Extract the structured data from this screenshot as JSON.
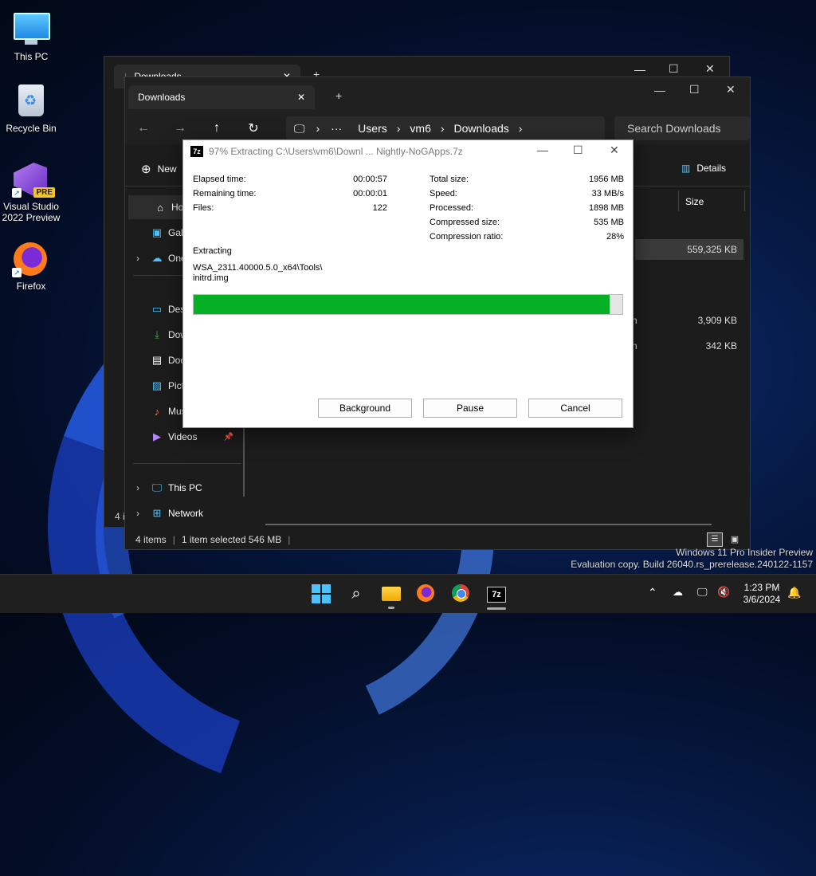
{
  "desktop": {
    "icons": [
      {
        "label": "This PC",
        "icon": "monitor-icon"
      },
      {
        "label": "Recycle Bin",
        "icon": "recycle-bin-icon"
      },
      {
        "label": "Visual Studio 2022 Preview",
        "icon": "visual-studio-icon",
        "badge": "PRE"
      },
      {
        "label": "Firefox",
        "icon": "firefox-icon"
      }
    ]
  },
  "explorer_back": {
    "tab_title": "Downloads",
    "partial_left_char": "4 i"
  },
  "explorer": {
    "tab_title": "Downloads",
    "new_tab_symbol": "+",
    "breadcrumb": [
      "Users",
      "vm6",
      "Downloads"
    ],
    "more_symbol": "···",
    "search_placeholder": "Search Downloads",
    "new_label": "New",
    "details_label": "Details",
    "column_size": "Size",
    "sidebar": [
      {
        "label": "Home",
        "icon": "home-icon"
      },
      {
        "label": "Gallery",
        "icon": "gallery-icon"
      },
      {
        "label": "OneDrive",
        "icon": "onedrive-icon"
      },
      {
        "label": "Desktop",
        "icon": "desktop-icon"
      },
      {
        "label": "Downloads",
        "icon": "download-icon"
      },
      {
        "label": "Documents",
        "icon": "documents-icon"
      },
      {
        "label": "Pictures",
        "icon": "pictures-icon"
      },
      {
        "label": "Music",
        "icon": "music-icon"
      },
      {
        "label": "Videos",
        "icon": "videos-icon"
      },
      {
        "label": "This PC",
        "icon": "this-pc-icon"
      },
      {
        "label": "Network",
        "icon": "network-icon"
      }
    ],
    "file_sizes": [
      "559,325 KB",
      "3,909 KB",
      "342 KB"
    ],
    "file_partial_chars": [
      "n",
      "n"
    ],
    "status_items": "4 items",
    "status_selected": "1 item selected  546 MB"
  },
  "dialog": {
    "title": "97% Extracting C:\\Users\\vm6\\Downl ... Nightly-NoGApps.7z",
    "logo": "7z",
    "left": [
      {
        "k": "Elapsed time:",
        "v": "00:00:57"
      },
      {
        "k": "Remaining time:",
        "v": "00:00:01"
      },
      {
        "k": "Files:",
        "v": "122"
      }
    ],
    "right": [
      {
        "k": "Total size:",
        "v": "1956 MB"
      },
      {
        "k": "Speed:",
        "v": "33 MB/s"
      },
      {
        "k": "Processed:",
        "v": "1898 MB"
      },
      {
        "k": "Compressed size:",
        "v": "535 MB"
      },
      {
        "k": "Compression ratio:",
        "v": "28%"
      }
    ],
    "status_label": "Extracting",
    "current_path_line1": "WSA_2311.40000.5.0_x64\\Tools\\",
    "current_path_line2": "initrd.img",
    "progress": 0.97,
    "buttons": {
      "background": "Background",
      "pause": "Pause",
      "cancel": "Cancel"
    }
  },
  "watermark": {
    "line1": "Windows 11 Pro Insider Preview",
    "line2": "Evaluation copy. Build 26040.rs_prerelease.240122-1157"
  },
  "taskbar": {
    "time": "1:23 PM",
    "date": "3/6/2024",
    "apps": [
      "start-icon",
      "search-icon",
      "file-explorer-icon",
      "firefox-icon",
      "chrome-icon",
      "7zip-icon"
    ]
  },
  "colors": {
    "progress_fill": "#06b025",
    "accent": "#4cc2ff"
  }
}
